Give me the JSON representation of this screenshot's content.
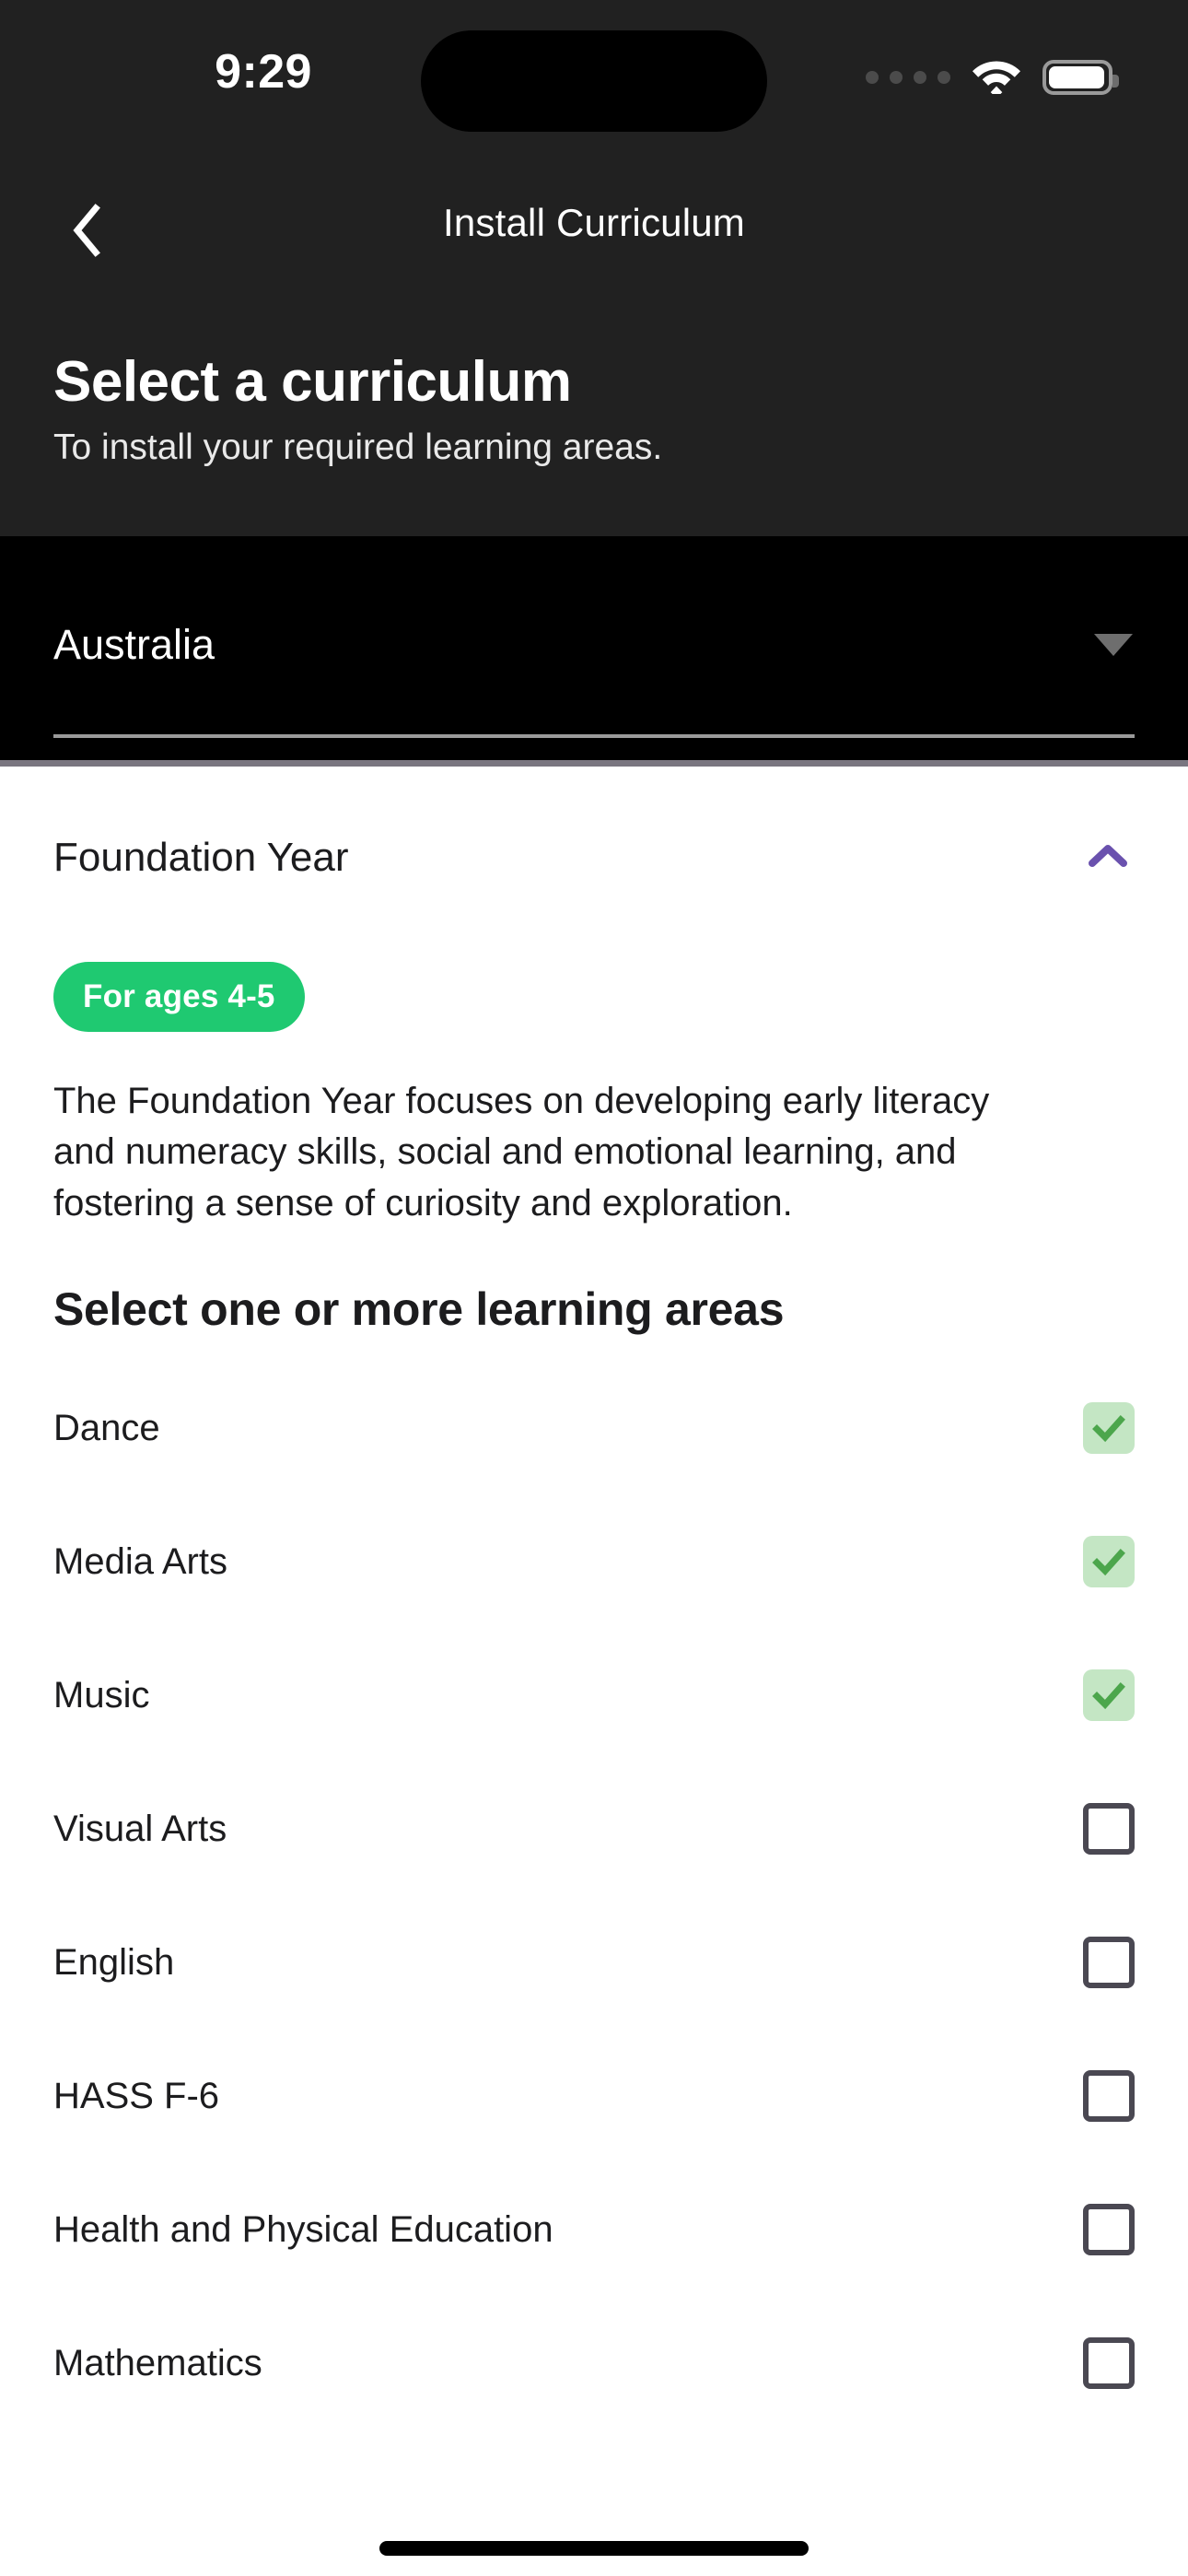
{
  "status_bar": {
    "time": "9:29",
    "cellular_icon": "cellular-dots-icon",
    "wifi_icon": "wifi-icon",
    "battery_icon": "battery-full-icon"
  },
  "nav": {
    "back_icon": "chevron-left-icon",
    "title": "Install Curriculum"
  },
  "header": {
    "title": "Select a curriculum",
    "subtitle": "To install your required learning areas."
  },
  "country_select": {
    "value": "Australia",
    "caret_icon": "caret-down-icon"
  },
  "accordion": {
    "title": "Foundation Year",
    "toggle_icon": "chevron-up-icon",
    "expanded": true,
    "badge": "For ages 4-5",
    "description": "The Foundation Year focuses on developing early literacy and numeracy skills, social and emotional learning, and fostering a sense of curiosity and exploration.",
    "areas_heading": "Select one or more learning areas"
  },
  "learning_areas": [
    {
      "label": "Dance",
      "checked": true
    },
    {
      "label": "Media Arts",
      "checked": true
    },
    {
      "label": "Music",
      "checked": true
    },
    {
      "label": "Visual Arts",
      "checked": false
    },
    {
      "label": "English",
      "checked": false
    },
    {
      "label": "HASS F-6",
      "checked": false
    },
    {
      "label": "Health and Physical Education",
      "checked": false
    },
    {
      "label": "Mathematics",
      "checked": false
    }
  ],
  "colors": {
    "header_bg": "#212121",
    "select_bg": "#000000",
    "badge_green": "#1fc971",
    "accent_purple": "#6a51ae",
    "checkbox_checked_bg": "#c4e6c4",
    "checkbox_check": "#4ca64c",
    "checkbox_border": "#4a4852",
    "divider": "#7a7680"
  }
}
